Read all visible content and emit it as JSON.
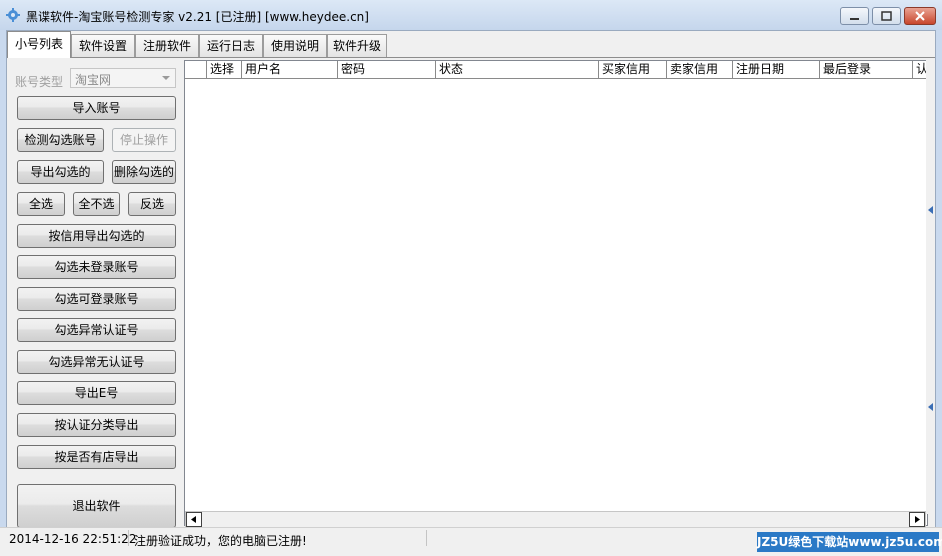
{
  "window": {
    "title": "黑谍软件-淘宝账号检测专家 v2.21 [已注册] [www.heydee.cn]"
  },
  "tabs": [
    {
      "label": "小号列表",
      "active": true
    },
    {
      "label": "软件设置"
    },
    {
      "label": "注册软件"
    },
    {
      "label": "运行日志"
    },
    {
      "label": "使用说明"
    },
    {
      "label": "软件升级"
    }
  ],
  "left_panel": {
    "account_type_label": "账号类型",
    "account_type_value": "淘宝网",
    "buttons": {
      "import": "导入账号",
      "check_selected": "检测勾选账号",
      "stop": "停止操作",
      "export_selected": "导出勾选的",
      "delete_selected": "删除勾选的",
      "select_all": "全选",
      "select_none": "全不选",
      "invert": "反选",
      "export_by_credit": "按信用导出勾选的",
      "select_not_logged": "勾选未登录账号",
      "select_loginable": "勾选可登录账号",
      "select_abnormal_cert": "勾选异常认证号",
      "select_abnormal_nocert": "勾选异常无认证号",
      "export_e": "导出E号",
      "export_by_cert": "按认证分类导出",
      "export_by_shop": "按是否有店导出",
      "exit": "退出软件"
    }
  },
  "grid": {
    "columns": [
      "",
      "选择",
      "用户名",
      "密码",
      "状态",
      "买家信用",
      "卖家信用",
      "注册日期",
      "最后登录",
      "认"
    ]
  },
  "status": {
    "time": "2014-12-16 22:51:22",
    "message": "注册验证成功，您的电脑已注册!"
  },
  "watermark": "JZ5U绿色下载站www.jz5u.com",
  "colors": {
    "titlebar": "#c5d6ec",
    "close_button": "#c8452c",
    "watermark_bg": "#2a79c6"
  }
}
